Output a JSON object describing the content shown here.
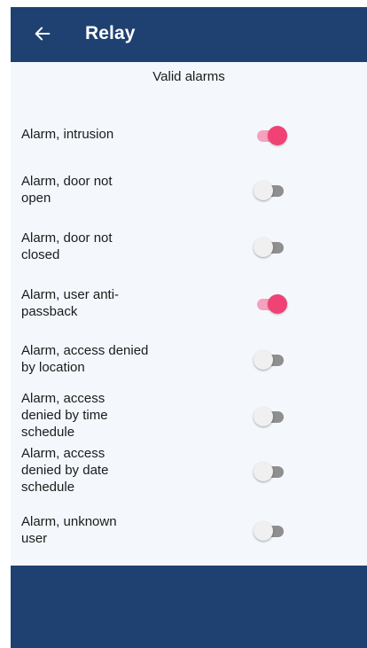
{
  "header": {
    "title": "Relay",
    "back_icon": "arrow-left-icon"
  },
  "section_title": "Valid alarms",
  "alarms": [
    {
      "label": "Alarm, intrusion",
      "enabled": true
    },
    {
      "label": "Alarm, door not open",
      "enabled": false
    },
    {
      "label": "Alarm, door not closed",
      "enabled": false
    },
    {
      "label": "Alarm, user anti-passback",
      "enabled": true
    },
    {
      "label": "Alarm, access denied by location",
      "enabled": false
    },
    {
      "label": "Alarm, access denied by time schedule",
      "enabled": false
    },
    {
      "label": "Alarm, access denied by date schedule",
      "enabled": false
    },
    {
      "label": "Alarm, unknown user",
      "enabled": false
    }
  ],
  "colors": {
    "primary": "#1f4171",
    "accent": "#f04274",
    "background": "#f4f8fd"
  }
}
